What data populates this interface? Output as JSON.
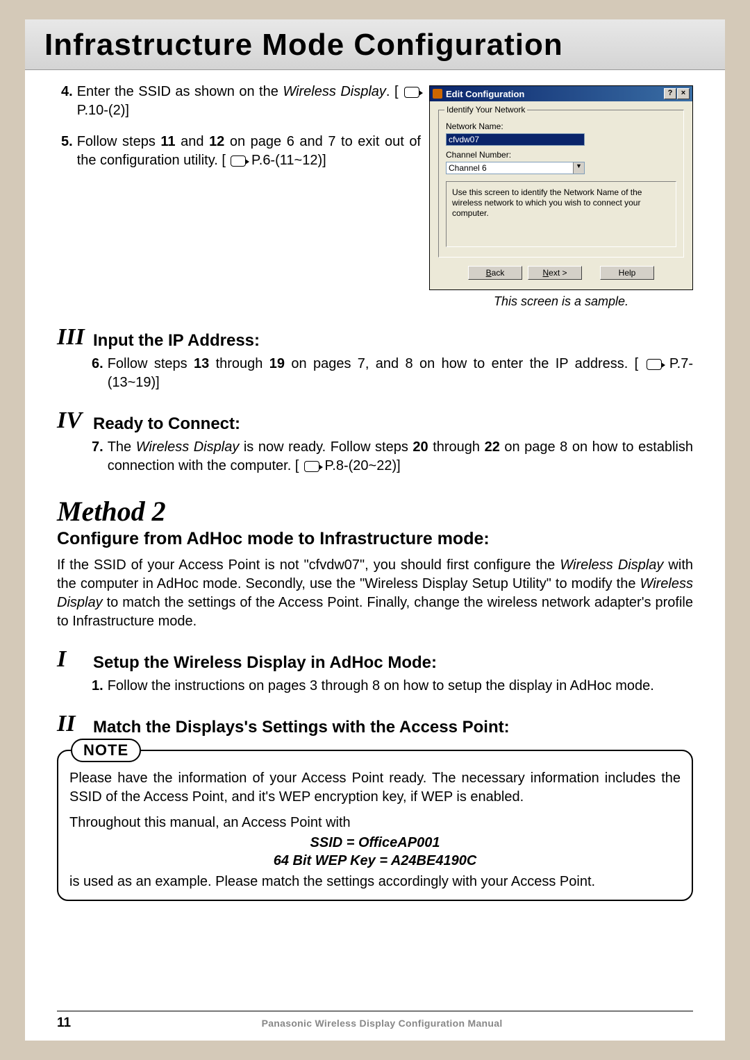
{
  "title": "Infrastructure Mode Configuration",
  "steps": {
    "s4_num": "4.",
    "s4_a": "Enter the SSID as shown on the ",
    "s4_b": "Wireless Display",
    "s4_c": ". [ ",
    "s4_d": " P.10-(2)]",
    "s5_num": "5.",
    "s5_a": "Follow steps ",
    "s5_b": "11",
    "s5_c": " and ",
    "s5_d": "12",
    "s5_e": " on page 6 and 7 to exit out  of the configuration utility. [ ",
    "s5_f": " P.6-(11~12)]"
  },
  "dialog": {
    "title": "Edit Configuration",
    "help": "?",
    "close": "×",
    "legend": "Identify Your Network",
    "name_label": "Network Name:",
    "name_value": "cfvdw07",
    "chan_label": "Channel Number:",
    "chan_value": "Channel 6",
    "hint": "Use this screen to identify the Network Name of the wireless network to which you wish to connect your computer.",
    "back": "< Back",
    "next": "Next >",
    "helpbtn": "Help"
  },
  "sample_caption": "This screen is a sample.",
  "sec3": {
    "roman": "III",
    "title": "Input the IP Address:",
    "num": "6.",
    "a": "Follow steps ",
    "b": "13",
    "c": " through ",
    "d": "19",
    "e": " on pages 7, and 8 on how to enter the IP address. [ ",
    "f": " P.7-(13~19)]"
  },
  "sec4": {
    "roman": "IV",
    "title": "Ready to Connect:",
    "num": "7.",
    "a": "The ",
    "b": "Wireless Display",
    "c": " is now ready. Follow steps ",
    "d": "20",
    "e": " through ",
    "f": "22",
    "g": " on page 8 on how to establish connection with the computer. [ ",
    "h": " P.8-(20~22)]"
  },
  "method2": {
    "heading": "Method 2",
    "sub": "Configure from AdHoc mode to Infrastructure mode:",
    "para_a": "If the SSID of your Access Point is not \"cfvdw07\", you should first configure the ",
    "para_b": "Wireless Display",
    "para_c": " with the computer in AdHoc mode. Secondly, use the \"Wireless Display Setup Utility\" to modify the ",
    "para_d": "Wireless Display",
    "para_e": " to match the settings of the Access Point. Finally, change the wireless network adapter's profile to Infrastructure mode."
  },
  "m2s1": {
    "roman": "I",
    "title": " Setup the Wireless Display in AdHoc Mode:",
    "num": "1.",
    "text": "Follow the instructions on pages 3 through 8 on how to setup the display in AdHoc mode."
  },
  "m2s2": {
    "roman": "II",
    "title": " Match the Displays's Settings with the Access Point:"
  },
  "note": {
    "tag": "NOTE",
    "p1": "Please have the information of your Access Point ready. The necessary information includes the SSID of the Access Point, and it's WEP encryption key,  if WEP is  enabled.",
    "p2": "Throughout this manual, an Access Point with",
    "ssid": "SSID = OfficeAP001",
    "wep": "64 Bit WEP Key = A24BE4190C",
    "p3": "is used as an example. Please match the settings accordingly with your Access Point."
  },
  "footer": {
    "page": "11",
    "title": "Panasonic Wireless Display Configuration Manual"
  }
}
